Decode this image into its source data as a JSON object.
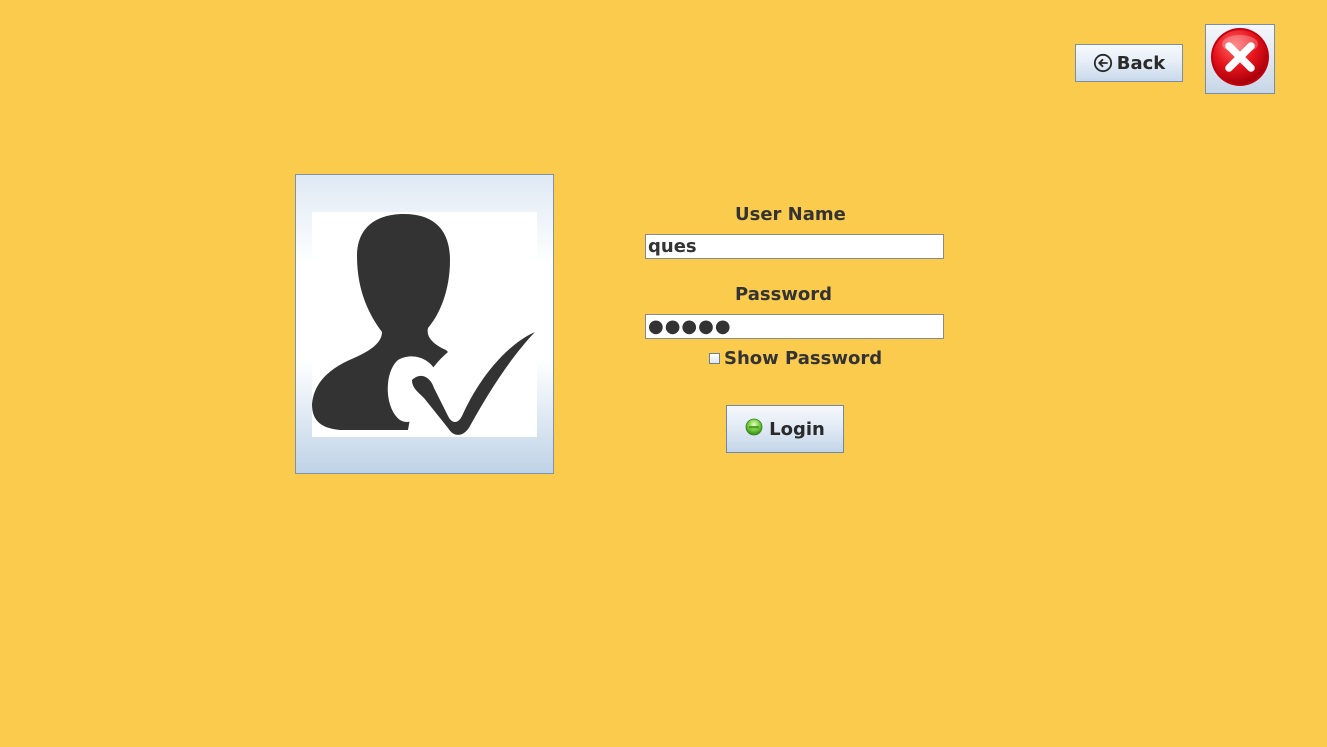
{
  "header": {
    "back_label": "Back",
    "back_icon": "arrow-left-circle-icon",
    "close_icon": "red-x-circle-icon"
  },
  "avatar": {
    "icon": "user-check-icon"
  },
  "form": {
    "username_label": "User Name",
    "username_value": "ques",
    "password_label": "Password",
    "password_value": "●●●●●",
    "show_password_label": "Show Password",
    "show_password_checked": false,
    "login_label": "Login",
    "login_icon": "green-orb-icon"
  },
  "colors": {
    "background": "#fbcb4d",
    "text": "#333333",
    "close_red": "#e8141c"
  }
}
